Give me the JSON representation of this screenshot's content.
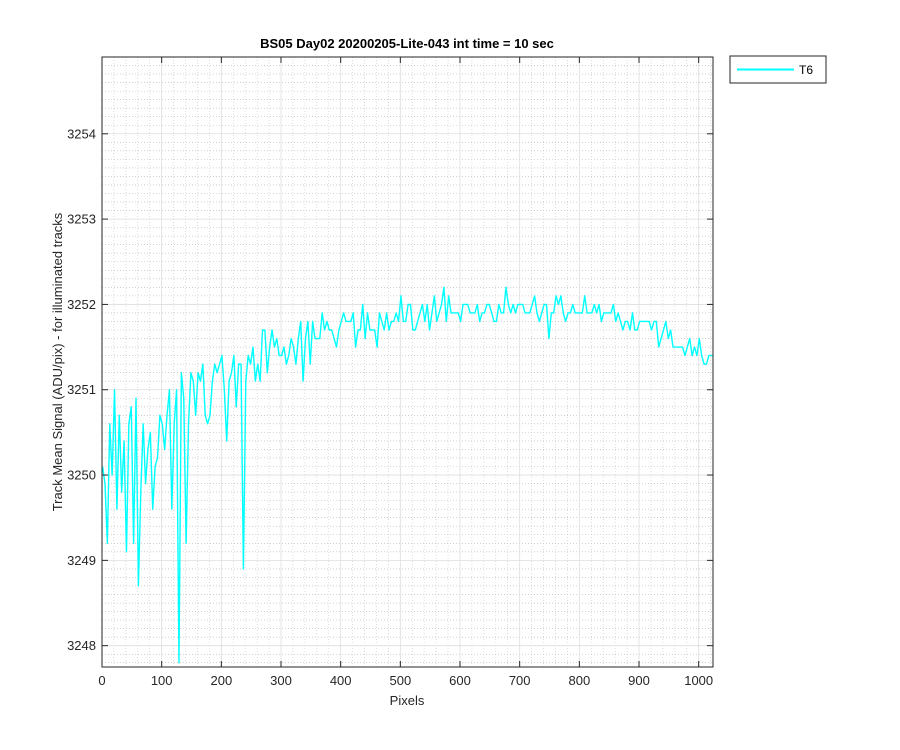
{
  "chart_data": {
    "type": "line",
    "title": "BS05 Day02 20200205-Lite-043 int time = 10 sec",
    "xlabel": "Pixels",
    "ylabel": "Track Mean Signal (ADU/pix) - for illuminated tracks",
    "xlim": [
      0,
      1024
    ],
    "ylim": [
      3247.75,
      3254.9
    ],
    "xticks": [
      0,
      100,
      200,
      300,
      400,
      500,
      600,
      700,
      800,
      900,
      1000
    ],
    "yticks": [
      3248,
      3249,
      3250,
      3251,
      3252,
      3253,
      3254
    ],
    "grid": true,
    "minor_grid": true,
    "legend_position": "outside-top-right",
    "series": [
      {
        "name": "T6",
        "color": "#00ffff",
        "sample_step": 4,
        "x_start": 1,
        "values": [
          3250.1,
          3249.9,
          3249.2,
          3250.6,
          3250.0,
          3251.0,
          3249.6,
          3250.7,
          3249.8,
          3250.4,
          3249.1,
          3250.6,
          3250.8,
          3249.2,
          3250.9,
          3248.7,
          3249.8,
          3250.6,
          3249.9,
          3250.3,
          3250.5,
          3249.6,
          3250.1,
          3250.2,
          3250.7,
          3250.6,
          3250.3,
          3250.7,
          3251.0,
          3249.6,
          3250.6,
          3251.0,
          3247.8,
          3251.2,
          3250.9,
          3249.2,
          3250.6,
          3251.2,
          3251.1,
          3250.7,
          3251.2,
          3251.1,
          3251.3,
          3250.7,
          3250.6,
          3250.7,
          3251.1,
          3251.3,
          3251.2,
          3251.3,
          3251.4,
          3251.0,
          3250.4,
          3251.1,
          3251.2,
          3251.4,
          3250.8,
          3251.3,
          3251.3,
          3248.9,
          3251.1,
          3251.4,
          3251.3,
          3251.5,
          3251.1,
          3251.3,
          3251.1,
          3251.7,
          3251.7,
          3251.2,
          3251.5,
          3251.7,
          3251.5,
          3251.6,
          3251.4,
          3251.4,
          3251.5,
          3251.3,
          3251.4,
          3251.6,
          3251.5,
          3251.3,
          3251.6,
          3251.8,
          3251.1,
          3251.6,
          3251.8,
          3251.3,
          3251.8,
          3251.6,
          3251.6,
          3251.6,
          3251.9,
          3251.7,
          3251.8,
          3251.7,
          3251.7,
          3251.6,
          3251.5,
          3251.7,
          3251.8,
          3251.9,
          3251.8,
          3251.8,
          3251.8,
          3251.9,
          3251.5,
          3251.7,
          3251.7,
          3252.0,
          3251.6,
          3251.9,
          3251.7,
          3251.7,
          3251.7,
          3251.5,
          3251.9,
          3251.8,
          3251.7,
          3251.9,
          3251.7,
          3251.8,
          3251.8,
          3251.9,
          3251.8,
          3252.1,
          3251.8,
          3251.8,
          3252.0,
          3252.0,
          3251.7,
          3251.7,
          3251.8,
          3251.9,
          3252.0,
          3251.8,
          3252.0,
          3251.7,
          3251.9,
          3252.1,
          3251.8,
          3251.9,
          3252.0,
          3252.2,
          3251.8,
          3252.1,
          3251.9,
          3251.9,
          3251.9,
          3251.9,
          3251.8,
          3252.0,
          3252.0,
          3252.0,
          3251.9,
          3251.9,
          3251.9,
          3252.0,
          3251.8,
          3251.9,
          3251.9,
          3252.0,
          3252.0,
          3251.9,
          3251.8,
          3251.8,
          3252.0,
          3251.9,
          3251.9,
          3252.2,
          3252.0,
          3251.9,
          3252.0,
          3251.9,
          3252.0,
          3252.0,
          3252.0,
          3251.9,
          3251.9,
          3251.9,
          3252.0,
          3252.1,
          3251.9,
          3251.8,
          3251.9,
          3252.0,
          3252.0,
          3251.6,
          3251.9,
          3251.9,
          3252.1,
          3252.0,
          3252.1,
          3251.9,
          3251.8,
          3251.9,
          3251.9,
          3252.0,
          3251.9,
          3251.9,
          3251.9,
          3251.9,
          3252.1,
          3251.9,
          3251.9,
          3251.9,
          3252.0,
          3251.9,
          3252.0,
          3251.8,
          3251.9,
          3251.9,
          3251.9,
          3251.9,
          3252.0,
          3251.8,
          3251.9,
          3251.8,
          3251.7,
          3251.8,
          3251.8,
          3251.7,
          3251.9,
          3251.7,
          3251.7,
          3251.8,
          3251.8,
          3251.8,
          3251.8,
          3251.8,
          3251.7,
          3251.8,
          3251.8,
          3251.5,
          3251.6,
          3251.7,
          3251.8,
          3251.6,
          3251.7,
          3251.5,
          3251.5,
          3251.5,
          3251.5,
          3251.5,
          3251.4,
          3251.5,
          3251.6,
          3251.4,
          3251.5,
          3251.4,
          3251.6,
          3251.4,
          3251.3,
          3251.3,
          3251.4,
          3251.4,
          3251.4,
          3251.2,
          3251.1,
          3251.5
        ]
      }
    ]
  },
  "legend": {
    "entries": [
      {
        "label": "T6",
        "color": "#00ffff"
      }
    ]
  }
}
